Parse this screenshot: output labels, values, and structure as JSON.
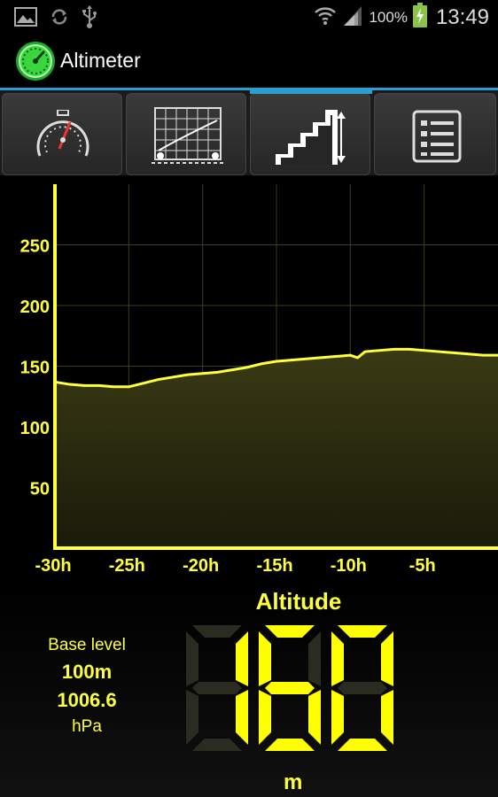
{
  "status_bar": {
    "battery_percent": "100%",
    "clock": "13:49",
    "icons": [
      "gallery-icon",
      "sync-icon",
      "usb-icon",
      "wifi-icon",
      "signal-icon",
      "battery-charging-icon"
    ]
  },
  "action_bar": {
    "title": "Altimeter",
    "app_icon": "gauge-icon"
  },
  "tabs": [
    {
      "icon": "gauge-dial-icon",
      "active": false
    },
    {
      "icon": "graph-icon",
      "active": false
    },
    {
      "icon": "stairs-altitude-icon",
      "active": true
    },
    {
      "icon": "list-icon",
      "active": false
    }
  ],
  "colors": {
    "accent": "#2c9fd2",
    "chart_line": "#ffff3a",
    "lcd_on": "#ffff00",
    "lcd_off": "#2a2c22"
  },
  "chart_data": {
    "type": "area",
    "x_tick_labels": [
      "-30h",
      "-25h",
      "-20h",
      "-15h",
      "-10h",
      "-5h"
    ],
    "y_tick_labels": [
      "50",
      "100",
      "150",
      "200",
      "250"
    ],
    "y_ticks": [
      50,
      100,
      150,
      200,
      250
    ],
    "x_ticks": [
      -30,
      -25,
      -20,
      -15,
      -10,
      -5
    ],
    "xlim": [
      -30,
      0
    ],
    "ylim": [
      0,
      300
    ],
    "grid": true,
    "x": [
      -30,
      -29,
      -28,
      -27,
      -26,
      -25,
      -24,
      -23,
      -22,
      -21,
      -20,
      -19,
      -18,
      -17,
      -16,
      -15,
      -14,
      -13,
      -12,
      -11,
      -10,
      -9.5,
      -9,
      -8,
      -7,
      -6,
      -5,
      -4,
      -3,
      -2,
      -1,
      0
    ],
    "values": [
      137,
      135,
      134,
      134,
      133,
      133,
      136,
      139,
      141,
      143,
      144,
      145,
      147,
      149,
      152,
      154,
      155,
      156,
      157,
      158,
      159,
      157,
      162,
      163,
      164,
      164,
      163,
      162,
      161,
      160,
      159,
      159
    ]
  },
  "readout": {
    "label": "Altitude",
    "value": "160",
    "unit": "m",
    "base_level_label": "Base level",
    "base_level_value": "100m",
    "base_pressure_value": "1006.6",
    "base_pressure_unit": "hPa"
  }
}
